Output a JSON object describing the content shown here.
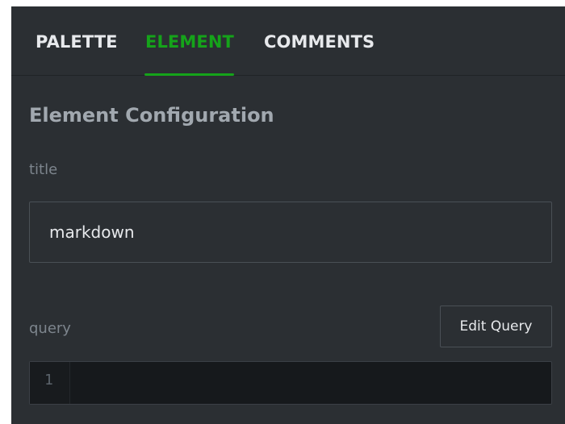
{
  "tabs": [
    {
      "label": "PALETTE",
      "active": false
    },
    {
      "label": "ELEMENT",
      "active": true
    },
    {
      "label": "COMMENTS",
      "active": false
    }
  ],
  "section_title": "Element Configuration",
  "fields": {
    "title": {
      "label": "title",
      "value": "markdown"
    },
    "query": {
      "label": "query",
      "edit_button_label": "Edit Query",
      "line_numbers": [
        "1"
      ],
      "code": ""
    }
  },
  "colors": {
    "panel_bg": "#2b2f33",
    "active_tab": "#15a31a",
    "tab_text": "#e7e9ec",
    "muted_text": "#7d858d",
    "editor_bg": "#16191c"
  }
}
